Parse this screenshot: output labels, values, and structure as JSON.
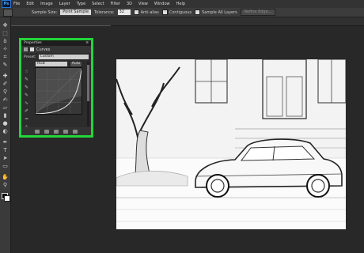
{
  "app": {
    "logo": "Ps"
  },
  "menu": [
    "File",
    "Edit",
    "Image",
    "Layer",
    "Type",
    "Select",
    "Filter",
    "3D",
    "View",
    "Window",
    "Help"
  ],
  "options": {
    "sample_size_label": "Sample Size:",
    "sample_size_value": "Point Sample",
    "tolerance_label": "Tolerance:",
    "tolerance_value": "32",
    "anti_alias_label": "Anti-alias",
    "contiguous_label": "Contiguous",
    "sample_all_layers_label": "Sample All Layers",
    "refine_edge_label": "Refine Edge..."
  },
  "document_tab": "13019550-1.psd @ 33% (Curves 1, Layer Mask/8) *",
  "properties": {
    "header": "Properties",
    "title": "Curves",
    "preset_label": "Preset:",
    "preset_value": "Custom",
    "channel_value": "RGB",
    "auto_label": "Auto"
  }
}
